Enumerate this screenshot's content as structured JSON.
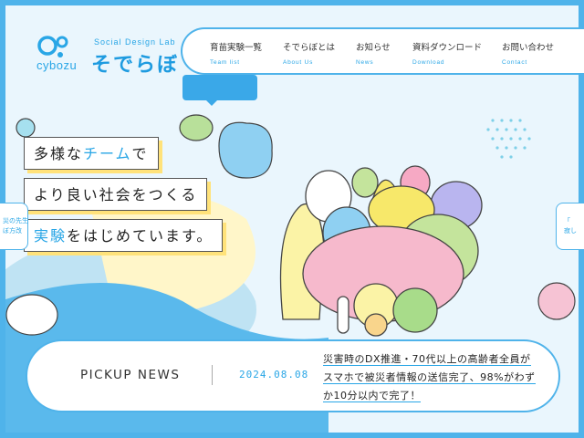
{
  "header": {
    "logo_word": "cybozu",
    "lab_subtitle": "Social Design Lab",
    "lab_title": "そでらぼ"
  },
  "nav": [
    {
      "ja": "育苗実験一覧",
      "en": "Team list"
    },
    {
      "ja": "そでらぼとは",
      "en": "About Us"
    },
    {
      "ja": "お知らせ",
      "en": "News"
    },
    {
      "ja": "資料ダウンロード",
      "en": "Download"
    },
    {
      "ja": "お問い合わせ",
      "en": "Contact"
    }
  ],
  "hero": {
    "line1_a": "多様な",
    "line1_b": "チーム",
    "line1_c": "で",
    "line2": "より良い社会をつくる",
    "line3_a": "実験",
    "line3_b": "をはじめています。"
  },
  "side": {
    "left_text": "災の先生\nぼ方改",
    "right_text": "「\n寂し"
  },
  "pickup": {
    "title": "PICKUP NEWS",
    "date": "2024.08.08",
    "text_line1": "災害時のDX推進・70代以上の高齢者全員が",
    "text_line2": "スマホで被災者情報の送信完了、98%がわず",
    "text_line3": "か10分以内で完了！"
  },
  "colors": {
    "accent": "#29a6e6",
    "frame": "#4fb3ea",
    "yellow_shadow": "#ffe27a",
    "background": "#eaf6fd"
  }
}
